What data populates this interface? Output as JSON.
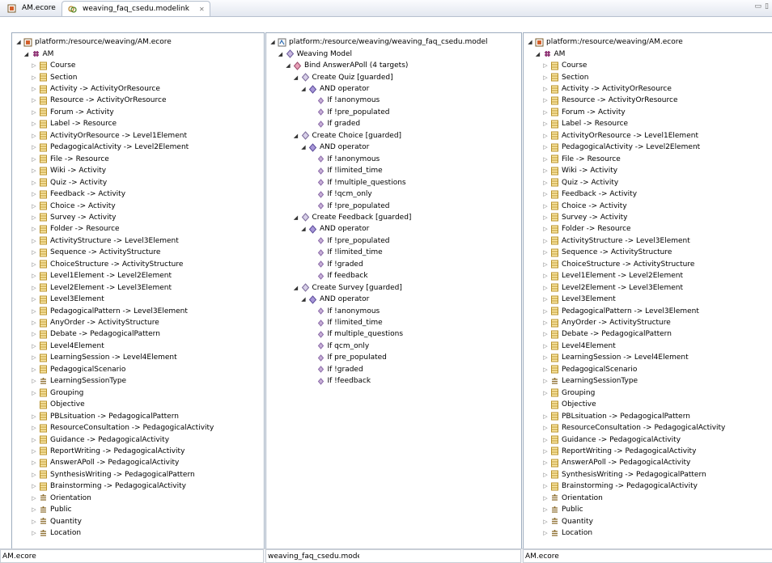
{
  "tabs": [
    {
      "label": "AM.ecore",
      "icon": "ecore-file-icon",
      "active": false
    },
    {
      "label": "weaving_faq_csedu.modelink",
      "icon": "modelink-file-icon",
      "active": true
    }
  ],
  "left_panel": {
    "status": "AM.ecore",
    "rows": [
      {
        "depth": 0,
        "tw": "exp",
        "icon": "resource",
        "label": "platform:/resource/weaving/AM.ecore"
      },
      {
        "depth": 1,
        "tw": "exp",
        "icon": "package",
        "label": "AM"
      },
      {
        "depth": 2,
        "tw": "col",
        "icon": "class",
        "label": "Course"
      },
      {
        "depth": 2,
        "tw": "col",
        "icon": "class",
        "label": "Section"
      },
      {
        "depth": 2,
        "tw": "col",
        "icon": "class",
        "label": "Activity -> ActivityOrResource"
      },
      {
        "depth": 2,
        "tw": "col",
        "icon": "class",
        "label": "Resource -> ActivityOrResource"
      },
      {
        "depth": 2,
        "tw": "col",
        "icon": "class",
        "label": "Forum -> Activity"
      },
      {
        "depth": 2,
        "tw": "col",
        "icon": "class",
        "label": "Label -> Resource"
      },
      {
        "depth": 2,
        "tw": "col",
        "icon": "class",
        "label": "ActivityOrResource -> Level1Element"
      },
      {
        "depth": 2,
        "tw": "col",
        "icon": "class",
        "label": "PedagogicalActivity -> Level2Element"
      },
      {
        "depth": 2,
        "tw": "col",
        "icon": "class",
        "label": "File -> Resource"
      },
      {
        "depth": 2,
        "tw": "col",
        "icon": "class",
        "label": "Wiki -> Activity"
      },
      {
        "depth": 2,
        "tw": "col",
        "icon": "class",
        "label": "Quiz -> Activity"
      },
      {
        "depth": 2,
        "tw": "col",
        "icon": "class",
        "label": "Feedback -> Activity"
      },
      {
        "depth": 2,
        "tw": "col",
        "icon": "class",
        "label": "Choice -> Activity"
      },
      {
        "depth": 2,
        "tw": "col",
        "icon": "class",
        "label": "Survey -> Activity"
      },
      {
        "depth": 2,
        "tw": "col",
        "icon": "class",
        "label": "Folder -> Resource"
      },
      {
        "depth": 2,
        "tw": "col",
        "icon": "class",
        "label": "ActivityStructure -> Level3Element"
      },
      {
        "depth": 2,
        "tw": "col",
        "icon": "class",
        "label": "Sequence -> ActivityStructure"
      },
      {
        "depth": 2,
        "tw": "col",
        "icon": "class",
        "label": "ChoiceStructure -> ActivityStructure"
      },
      {
        "depth": 2,
        "tw": "col",
        "icon": "class",
        "label": "Level1Element -> Level2Element"
      },
      {
        "depth": 2,
        "tw": "col",
        "icon": "class",
        "label": "Level2Element -> Level3Element"
      },
      {
        "depth": 2,
        "tw": "col",
        "icon": "class",
        "label": "Level3Element"
      },
      {
        "depth": 2,
        "tw": "col",
        "icon": "class",
        "label": "PedagogicalPattern -> Level3Element"
      },
      {
        "depth": 2,
        "tw": "col",
        "icon": "class",
        "label": "AnyOrder -> ActivityStructure"
      },
      {
        "depth": 2,
        "tw": "col",
        "icon": "class",
        "label": "Debate -> PedagogicalPattern"
      },
      {
        "depth": 2,
        "tw": "col",
        "icon": "class",
        "label": "Level4Element"
      },
      {
        "depth": 2,
        "tw": "col",
        "icon": "class",
        "label": "LearningSession -> Level4Element"
      },
      {
        "depth": 2,
        "tw": "col",
        "icon": "class",
        "label": "PedagogicalScenario"
      },
      {
        "depth": 2,
        "tw": "col",
        "icon": "enum",
        "label": "LearningSessionType"
      },
      {
        "depth": 2,
        "tw": "col",
        "icon": "class",
        "label": "Grouping"
      },
      {
        "depth": 2,
        "tw": "none",
        "icon": "class",
        "label": "Objective"
      },
      {
        "depth": 2,
        "tw": "col",
        "icon": "class",
        "label": "PBLsituation -> PedagogicalPattern"
      },
      {
        "depth": 2,
        "tw": "col",
        "icon": "class",
        "label": "ResourceConsultation -> PedagogicalActivity"
      },
      {
        "depth": 2,
        "tw": "col",
        "icon": "class",
        "label": "Guidance -> PedagogicalActivity"
      },
      {
        "depth": 2,
        "tw": "col",
        "icon": "class",
        "label": "ReportWriting -> PedagogicalActivity"
      },
      {
        "depth": 2,
        "tw": "col",
        "icon": "class",
        "label": "AnswerAPoll -> PedagogicalActivity"
      },
      {
        "depth": 2,
        "tw": "col",
        "icon": "class",
        "label": "SynthesisWriting -> PedagogicalPattern"
      },
      {
        "depth": 2,
        "tw": "col",
        "icon": "class",
        "label": "Brainstorming -> PedagogicalActivity"
      },
      {
        "depth": 2,
        "tw": "col",
        "icon": "enum",
        "label": "Orientation"
      },
      {
        "depth": 2,
        "tw": "col",
        "icon": "enum",
        "label": "Public"
      },
      {
        "depth": 2,
        "tw": "col",
        "icon": "enum",
        "label": "Quantity"
      },
      {
        "depth": 2,
        "tw": "col",
        "icon": "enum",
        "label": "Location"
      }
    ]
  },
  "middle_panel": {
    "status": "weaving_faq_csedu.model",
    "rows": [
      {
        "depth": 0,
        "tw": "exp",
        "icon": "modelres",
        "label": "platform:/resource/weaving/weaving_faq_csedu.model"
      },
      {
        "depth": 1,
        "tw": "exp",
        "icon": "wmodel",
        "label": "Weaving Model"
      },
      {
        "depth": 2,
        "tw": "exp",
        "icon": "bind",
        "label": "Bind AnswerAPoll (4 targets)"
      },
      {
        "depth": 3,
        "tw": "exp",
        "icon": "create",
        "label": "Create Quiz [guarded]"
      },
      {
        "depth": 4,
        "tw": "exp",
        "icon": "andop",
        "label": "AND operator"
      },
      {
        "depth": 5,
        "tw": "none",
        "icon": "cond",
        "label": "If !anonymous"
      },
      {
        "depth": 5,
        "tw": "none",
        "icon": "cond",
        "label": "If !pre_populated"
      },
      {
        "depth": 5,
        "tw": "none",
        "icon": "cond",
        "label": "If graded"
      },
      {
        "depth": 3,
        "tw": "exp",
        "icon": "create",
        "label": "Create Choice [guarded]"
      },
      {
        "depth": 4,
        "tw": "exp",
        "icon": "andop",
        "label": "AND operator"
      },
      {
        "depth": 5,
        "tw": "none",
        "icon": "cond",
        "label": "If !anonymous"
      },
      {
        "depth": 5,
        "tw": "none",
        "icon": "cond",
        "label": "If !limited_time"
      },
      {
        "depth": 5,
        "tw": "none",
        "icon": "cond",
        "label": "If !multiple_questions"
      },
      {
        "depth": 5,
        "tw": "none",
        "icon": "cond",
        "label": "If !qcm_only"
      },
      {
        "depth": 5,
        "tw": "none",
        "icon": "cond",
        "label": "If !pre_populated"
      },
      {
        "depth": 3,
        "tw": "exp",
        "icon": "create",
        "label": "Create Feedback [guarded]"
      },
      {
        "depth": 4,
        "tw": "exp",
        "icon": "andop",
        "label": "AND operator"
      },
      {
        "depth": 5,
        "tw": "none",
        "icon": "cond",
        "label": "If !pre_populated"
      },
      {
        "depth": 5,
        "tw": "none",
        "icon": "cond",
        "label": "If !limited_time"
      },
      {
        "depth": 5,
        "tw": "none",
        "icon": "cond",
        "label": "If !graded"
      },
      {
        "depth": 5,
        "tw": "none",
        "icon": "cond",
        "label": "If feedback"
      },
      {
        "depth": 3,
        "tw": "exp",
        "icon": "create",
        "label": "Create Survey [guarded]"
      },
      {
        "depth": 4,
        "tw": "exp",
        "icon": "andop",
        "label": "AND operator"
      },
      {
        "depth": 5,
        "tw": "none",
        "icon": "cond",
        "label": "If !anonymous"
      },
      {
        "depth": 5,
        "tw": "none",
        "icon": "cond",
        "label": "If !limited_time"
      },
      {
        "depth": 5,
        "tw": "none",
        "icon": "cond",
        "label": "If multiple_questions"
      },
      {
        "depth": 5,
        "tw": "none",
        "icon": "cond",
        "label": "If qcm_only"
      },
      {
        "depth": 5,
        "tw": "none",
        "icon": "cond",
        "label": "If pre_populated"
      },
      {
        "depth": 5,
        "tw": "none",
        "icon": "cond",
        "label": "If !graded"
      },
      {
        "depth": 5,
        "tw": "none",
        "icon": "cond",
        "label": "If !feedback"
      }
    ]
  },
  "right_panel": {
    "status": "AM.ecore",
    "rows": [
      {
        "depth": 0,
        "tw": "exp",
        "icon": "resource",
        "label": "platform:/resource/weaving/AM.ecore"
      },
      {
        "depth": 1,
        "tw": "exp",
        "icon": "package",
        "label": "AM"
      },
      {
        "depth": 2,
        "tw": "col",
        "icon": "class",
        "label": "Course"
      },
      {
        "depth": 2,
        "tw": "col",
        "icon": "class",
        "label": "Section"
      },
      {
        "depth": 2,
        "tw": "col",
        "icon": "class",
        "label": "Activity -> ActivityOrResource"
      },
      {
        "depth": 2,
        "tw": "col",
        "icon": "class",
        "label": "Resource -> ActivityOrResource"
      },
      {
        "depth": 2,
        "tw": "col",
        "icon": "class",
        "label": "Forum -> Activity"
      },
      {
        "depth": 2,
        "tw": "col",
        "icon": "class",
        "label": "Label -> Resource"
      },
      {
        "depth": 2,
        "tw": "col",
        "icon": "class",
        "label": "ActivityOrResource -> Level1Element"
      },
      {
        "depth": 2,
        "tw": "col",
        "icon": "class",
        "label": "PedagogicalActivity -> Level2Element"
      },
      {
        "depth": 2,
        "tw": "col",
        "icon": "class",
        "label": "File -> Resource"
      },
      {
        "depth": 2,
        "tw": "col",
        "icon": "class",
        "label": "Wiki -> Activity"
      },
      {
        "depth": 2,
        "tw": "col",
        "icon": "class",
        "label": "Quiz -> Activity"
      },
      {
        "depth": 2,
        "tw": "col",
        "icon": "class",
        "label": "Feedback -> Activity"
      },
      {
        "depth": 2,
        "tw": "col",
        "icon": "class",
        "label": "Choice -> Activity"
      },
      {
        "depth": 2,
        "tw": "col",
        "icon": "class",
        "label": "Survey -> Activity"
      },
      {
        "depth": 2,
        "tw": "col",
        "icon": "class",
        "label": "Folder -> Resource"
      },
      {
        "depth": 2,
        "tw": "col",
        "icon": "class",
        "label": "ActivityStructure -> Level3Element"
      },
      {
        "depth": 2,
        "tw": "col",
        "icon": "class",
        "label": "Sequence -> ActivityStructure"
      },
      {
        "depth": 2,
        "tw": "col",
        "icon": "class",
        "label": "ChoiceStructure -> ActivityStructure"
      },
      {
        "depth": 2,
        "tw": "col",
        "icon": "class",
        "label": "Level1Element -> Level2Element"
      },
      {
        "depth": 2,
        "tw": "col",
        "icon": "class",
        "label": "Level2Element -> Level3Element"
      },
      {
        "depth": 2,
        "tw": "col",
        "icon": "class",
        "label": "Level3Element"
      },
      {
        "depth": 2,
        "tw": "col",
        "icon": "class",
        "label": "PedagogicalPattern -> Level3Element"
      },
      {
        "depth": 2,
        "tw": "col",
        "icon": "class",
        "label": "AnyOrder -> ActivityStructure"
      },
      {
        "depth": 2,
        "tw": "col",
        "icon": "class",
        "label": "Debate -> PedagogicalPattern"
      },
      {
        "depth": 2,
        "tw": "col",
        "icon": "class",
        "label": "Level4Element"
      },
      {
        "depth": 2,
        "tw": "col",
        "icon": "class",
        "label": "LearningSession -> Level4Element"
      },
      {
        "depth": 2,
        "tw": "col",
        "icon": "class",
        "label": "PedagogicalScenario"
      },
      {
        "depth": 2,
        "tw": "col",
        "icon": "enum",
        "label": "LearningSessionType"
      },
      {
        "depth": 2,
        "tw": "col",
        "icon": "class",
        "label": "Grouping"
      },
      {
        "depth": 2,
        "tw": "none",
        "icon": "class",
        "label": "Objective"
      },
      {
        "depth": 2,
        "tw": "col",
        "icon": "class",
        "label": "PBLsituation -> PedagogicalPattern"
      },
      {
        "depth": 2,
        "tw": "col",
        "icon": "class",
        "label": "ResourceConsultation -> PedagogicalActivity"
      },
      {
        "depth": 2,
        "tw": "col",
        "icon": "class",
        "label": "Guidance -> PedagogicalActivity"
      },
      {
        "depth": 2,
        "tw": "col",
        "icon": "class",
        "label": "ReportWriting -> PedagogicalActivity"
      },
      {
        "depth": 2,
        "tw": "col",
        "icon": "class",
        "label": "AnswerAPoll -> PedagogicalActivity"
      },
      {
        "depth": 2,
        "tw": "col",
        "icon": "class",
        "label": "SynthesisWriting -> PedagogicalPattern"
      },
      {
        "depth": 2,
        "tw": "col",
        "icon": "class",
        "label": "Brainstorming -> PedagogicalActivity"
      },
      {
        "depth": 2,
        "tw": "col",
        "icon": "enum",
        "label": "Orientation"
      },
      {
        "depth": 2,
        "tw": "col",
        "icon": "enum",
        "label": "Public"
      },
      {
        "depth": 2,
        "tw": "col",
        "icon": "enum",
        "label": "Quantity"
      },
      {
        "depth": 2,
        "tw": "col",
        "icon": "enum",
        "label": "Location"
      }
    ]
  },
  "colors": {
    "class_icon": "#e8c34a",
    "package_icon": "#8a2a6e",
    "weave_icon": "#9a7fb8",
    "tree_twisty": "#7a7a7a"
  }
}
